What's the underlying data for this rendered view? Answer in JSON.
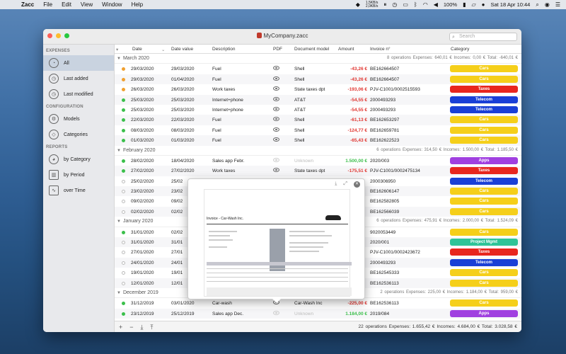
{
  "menubar": {
    "app": "Zacc",
    "menus": [
      "File",
      "Edit",
      "View",
      "Window",
      "Help"
    ],
    "net_up": "1,5KB/s",
    "net_down": "2,0KB/s",
    "battery": "100%",
    "datetime": "Sat 18 Apr  10:44"
  },
  "window": {
    "title": "MyCompany.zacc",
    "search_placeholder": "Search"
  },
  "sidebar": {
    "sections": [
      {
        "label": "EXPENSES",
        "items": [
          {
            "label": "All",
            "icon": "piggy-bank-icon",
            "active": true
          },
          {
            "label": "Last added",
            "icon": "clock-plus-icon"
          },
          {
            "label": "Last modified",
            "icon": "clock-edit-icon"
          }
        ]
      },
      {
        "label": "CONFIGURATION",
        "items": [
          {
            "label": "Models",
            "icon": "models-icon"
          },
          {
            "label": "Categories",
            "icon": "tag-icon"
          }
        ]
      },
      {
        "label": "REPORTS",
        "items": [
          {
            "label": "by Category",
            "icon": "pie-chart-icon"
          },
          {
            "label": "by Period",
            "icon": "bar-chart-icon"
          },
          {
            "label": "over Time",
            "icon": "line-chart-icon"
          }
        ]
      }
    ]
  },
  "table": {
    "headers": {
      "date": "Date",
      "date_value": "Date value",
      "description": "Description",
      "pdf": "PDF",
      "model": "Document model",
      "amount": "Amount",
      "invoice": "Invoice n°",
      "category": "Category"
    },
    "groups": [
      {
        "name": "March 2020",
        "stats": "8 operations   Expenses: 640,01 €   Incomes: 0,00 €   Total: -640,01 €",
        "rows": [
          {
            "status": "orange",
            "date": "29/03/2020",
            "value": "29/03/2020",
            "desc": "Fuel",
            "pdf": true,
            "model": "Shell",
            "amount": "-43,26 €",
            "invoice": "BE162664507",
            "cat": "Cars",
            "color": "#f5cf1a"
          },
          {
            "status": "orange",
            "date": "29/03/2020",
            "value": "01/04/2020",
            "desc": "Fuel",
            "pdf": true,
            "model": "Shell",
            "amount": "-43,26 €",
            "invoice": "BE162664507",
            "cat": "Cars",
            "color": "#f5cf1a"
          },
          {
            "status": "orange",
            "date": "26/03/2020",
            "value": "26/03/2020",
            "desc": "Work taxes",
            "pdf": true,
            "model": "State taxes dpt",
            "amount": "-193,06 €",
            "invoice": "PJV-C1001/0002515593",
            "cat": "Taxes",
            "color": "#e8261e"
          },
          {
            "status": "green",
            "date": "25/03/2020",
            "value": "25/03/2020",
            "desc": "Internet+phone",
            "pdf": true,
            "model": "AT&T",
            "amount": "-54,55 €",
            "invoice": "2000493293",
            "cat": "Telecom",
            "color": "#1a3fd6"
          },
          {
            "status": "green",
            "date": "25/03/2020",
            "value": "25/03/2020",
            "desc": "Internet+phone",
            "pdf": true,
            "model": "AT&T",
            "amount": "-54,55 €",
            "invoice": "2000493293",
            "cat": "Telecom",
            "color": "#1a3fd6"
          },
          {
            "status": "green",
            "date": "22/03/2020",
            "value": "22/03/2020",
            "desc": "Fuel",
            "pdf": true,
            "model": "Shell",
            "amount": "-61,13 €",
            "invoice": "BE162653297",
            "cat": "Cars",
            "color": "#f5cf1a"
          },
          {
            "status": "green",
            "date": "08/03/2020",
            "value": "08/03/2020",
            "desc": "Fuel",
            "pdf": true,
            "model": "Shell",
            "amount": "-124,77 €",
            "invoice": "BE162659781",
            "cat": "Cars",
            "color": "#f5cf1a"
          },
          {
            "status": "green",
            "date": "01/03/2020",
            "value": "01/03/2020",
            "desc": "Fuel",
            "pdf": true,
            "model": "Shell",
            "amount": "-65,43 €",
            "invoice": "BE162622523",
            "cat": "Cars",
            "color": "#f5cf1a"
          }
        ]
      },
      {
        "name": "February 2020",
        "stats": "6 operations   Expenses: 314,50 €   Incomes: 1.500,00 €   Total: 1.185,50 €",
        "rows": [
          {
            "status": "green",
            "date": "28/02/2020",
            "value": "18/04/2020",
            "desc": "Sales app Febr.",
            "pdf": false,
            "model": "Unknown",
            "amount": "1.500,00 €",
            "invoice": "2020/003",
            "cat": "Apps",
            "color": "#a040e0"
          },
          {
            "status": "green",
            "date": "27/02/2020",
            "value": "27/02/2020",
            "desc": "Work taxes",
            "pdf": true,
            "model": "State taxes dpt",
            "amount": "-175,51 €",
            "invoice": "PJV-C1001/0002475134",
            "cat": "Taxes",
            "color": "#e8261e"
          },
          {
            "status": "grey",
            "date": "25/02/2020",
            "value": "25/02",
            "desc": "",
            "pdf": null,
            "model": "",
            "amount": "",
            "invoice": "2000306950",
            "cat": "Telecom",
            "color": "#1a3fd6"
          },
          {
            "status": "grey",
            "date": "23/02/2020",
            "value": "23/02",
            "desc": "",
            "pdf": null,
            "model": "",
            "amount": "",
            "invoice": "BE162606147",
            "cat": "Cars",
            "color": "#f5cf1a"
          },
          {
            "status": "grey",
            "date": "09/02/2020",
            "value": "09/02",
            "desc": "",
            "pdf": null,
            "model": "",
            "amount": "",
            "invoice": "BE162582805",
            "cat": "Cars",
            "color": "#f5cf1a"
          },
          {
            "status": "grey",
            "date": "02/02/2020",
            "value": "02/02",
            "desc": "",
            "pdf": null,
            "model": "",
            "amount": "",
            "invoice": "BE162566039",
            "cat": "Cars",
            "color": "#f5cf1a"
          }
        ]
      },
      {
        "name": "January 2020",
        "stats": "6 operations   Expenses: 475,91 €   Incomes: 2.000,00 €   Total: 1.524,09 €",
        "rows": [
          {
            "status": "green",
            "date": "31/01/2020",
            "value": "02/02",
            "desc": "",
            "pdf": null,
            "model": "",
            "amount": "",
            "invoice": "9020053449",
            "cat": "Cars",
            "color": "#f5cf1a"
          },
          {
            "status": "grey",
            "date": "31/01/2020",
            "value": "31/01",
            "desc": "",
            "pdf": null,
            "model": "",
            "amount": "",
            "invoice": "2020/001",
            "cat": "Project Mgmt",
            "color": "#2ec498"
          },
          {
            "status": "grey",
            "date": "27/01/2020",
            "value": "27/01",
            "desc": "",
            "pdf": null,
            "model": "",
            "amount": "",
            "invoice": "PJV-C1001/0002423672",
            "cat": "Taxes",
            "color": "#e8261e"
          },
          {
            "status": "grey",
            "date": "24/01/2020",
            "value": "24/01",
            "desc": "",
            "pdf": null,
            "model": "",
            "amount": "",
            "invoice": "2000493293",
            "cat": "Telecom",
            "color": "#1a3fd6"
          },
          {
            "status": "grey",
            "date": "19/01/2020",
            "value": "19/01",
            "desc": "",
            "pdf": null,
            "model": "",
            "amount": "",
            "invoice": "BE162545333",
            "cat": "Cars",
            "color": "#f5cf1a"
          },
          {
            "status": "grey",
            "date": "12/01/2020",
            "value": "12/01",
            "desc": "",
            "pdf": null,
            "model": "",
            "amount": "",
            "invoice": "BE162536113",
            "cat": "Cars",
            "color": "#f5cf1a"
          }
        ]
      },
      {
        "name": "December 2019",
        "stats": "2 operations   Expenses: 225,00 €   Incomes: 1.184,00 €   Total: 959,00 €",
        "rows": [
          {
            "status": "green",
            "date": "31/12/2019",
            "value": "03/01/2020",
            "desc": "Car-wash",
            "pdf": true,
            "model": "Car-Wash Inc",
            "amount": "-225,00 €",
            "invoice": "BE162536113",
            "cat": "Cars",
            "color": "#f5cf1a"
          },
          {
            "status": "green",
            "date": "23/12/2019",
            "value": "25/12/2019",
            "desc": "Sales app Dec.",
            "pdf": false,
            "model": "Unknown",
            "amount": "1.184,00 €",
            "invoice": "2019/084",
            "cat": "Apps",
            "color": "#a040e0"
          }
        ]
      }
    ]
  },
  "footer": {
    "buttons": [
      "+",
      "−",
      "⤓",
      "⤒"
    ],
    "stats": "22 operations   Expenses: 1.655,42 €   Incomes: 4.684,00 €   Total: 3.028,58 €"
  },
  "preview": {
    "doc_title": "Invoice - Car-Wash Inc."
  }
}
